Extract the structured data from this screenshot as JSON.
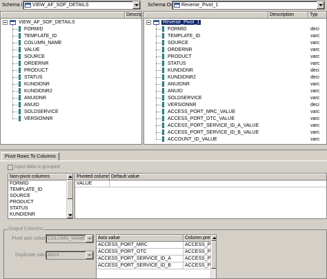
{
  "schema_in": {
    "label": "Schema In:",
    "value": "VIEW_AF_SOF_DETAILS",
    "col_description": "Descriptio",
    "root": "VIEW_AF_SOF_DETAILS",
    "fields": [
      "FORMID",
      "TEMPLATE_ID",
      "COLUMN_NAME",
      "VALUE",
      "SOURCE",
      "ORDERNR",
      "PRODUCT",
      "STATUS",
      "KUNDIDNR",
      "KUNDIDNR2",
      "ANUIDNR",
      "ANUID",
      "SOLDSERVICE",
      "VERSIONNR"
    ]
  },
  "schema_out": {
    "label": "Schema Out:",
    "value": "Reverse_Pivot_1",
    "col_description": "Description",
    "col_type": "Typ",
    "root": "Reverse_Pivot_1",
    "fields": [
      {
        "name": "FORMID",
        "type": "deci"
      },
      {
        "name": "TEMPLATE_ID",
        "type": "varc"
      },
      {
        "name": "SOURCE",
        "type": "varc"
      },
      {
        "name": "ORDERNR",
        "type": "varc"
      },
      {
        "name": "PRODUCT",
        "type": "varc"
      },
      {
        "name": "STATUS",
        "type": "varc"
      },
      {
        "name": "KUNDIDNR",
        "type": "deci"
      },
      {
        "name": "KUNDIDNR2",
        "type": "deci"
      },
      {
        "name": "ANUIDNR",
        "type": "varc"
      },
      {
        "name": "ANUID",
        "type": "varc"
      },
      {
        "name": "SOLDSERVICE",
        "type": "varc"
      },
      {
        "name": "VERSIONNR",
        "type": "deci"
      },
      {
        "name": "ACCESS_PORT_MRC_VALUE",
        "type": "varc"
      },
      {
        "name": "ACCESS_PORT_OTC_VALUE",
        "type": "varc"
      },
      {
        "name": "ACCESS_PORT_SERVICE_ID_A_VALUE",
        "type": "varc"
      },
      {
        "name": "ACCESS_PORT_SERVICE_ID_B_VALUE",
        "type": "varc"
      },
      {
        "name": "ACCOUNT_ID_VALUE",
        "type": "varc"
      }
    ]
  },
  "tab_label": "Pivot Rows To Columns",
  "input_grouped_label": "Input data is grouped",
  "non_pivot": {
    "header": "Non-pivot columns",
    "items": [
      "FORMID",
      "TEMPLATE_ID",
      "SOURCE",
      "PRODUCT",
      "STATUS",
      "KUNDIDNR"
    ]
  },
  "pivoted": {
    "col_pivoted": "Pivoted columns",
    "col_default": "Default value",
    "rows": [
      {
        "column": "VALUE",
        "default": ""
      }
    ]
  },
  "output_columns": {
    "title": "Output Columns",
    "pivot_axis_label": "Pivot axis column:",
    "pivot_axis_value": "COLUMN_NAME",
    "duplicate_label": "Duplicate value:",
    "duplicate_value": "Abort",
    "col_axis": "Axis value",
    "col_prefix": "Column pref",
    "rows": [
      {
        "axis": "ACCESS_PORT_MRC",
        "prefix": "ACCESS_P"
      },
      {
        "axis": "ACCESS_PORT_OTC",
        "prefix": "ACCESS_P"
      },
      {
        "axis": "ACCESS_PORT_SERVICE_ID_A",
        "prefix": "ACCESS_P"
      },
      {
        "axis": "ACCESS_PORT_SERVICE_ID_B",
        "prefix": "ACCESS_P"
      }
    ]
  }
}
